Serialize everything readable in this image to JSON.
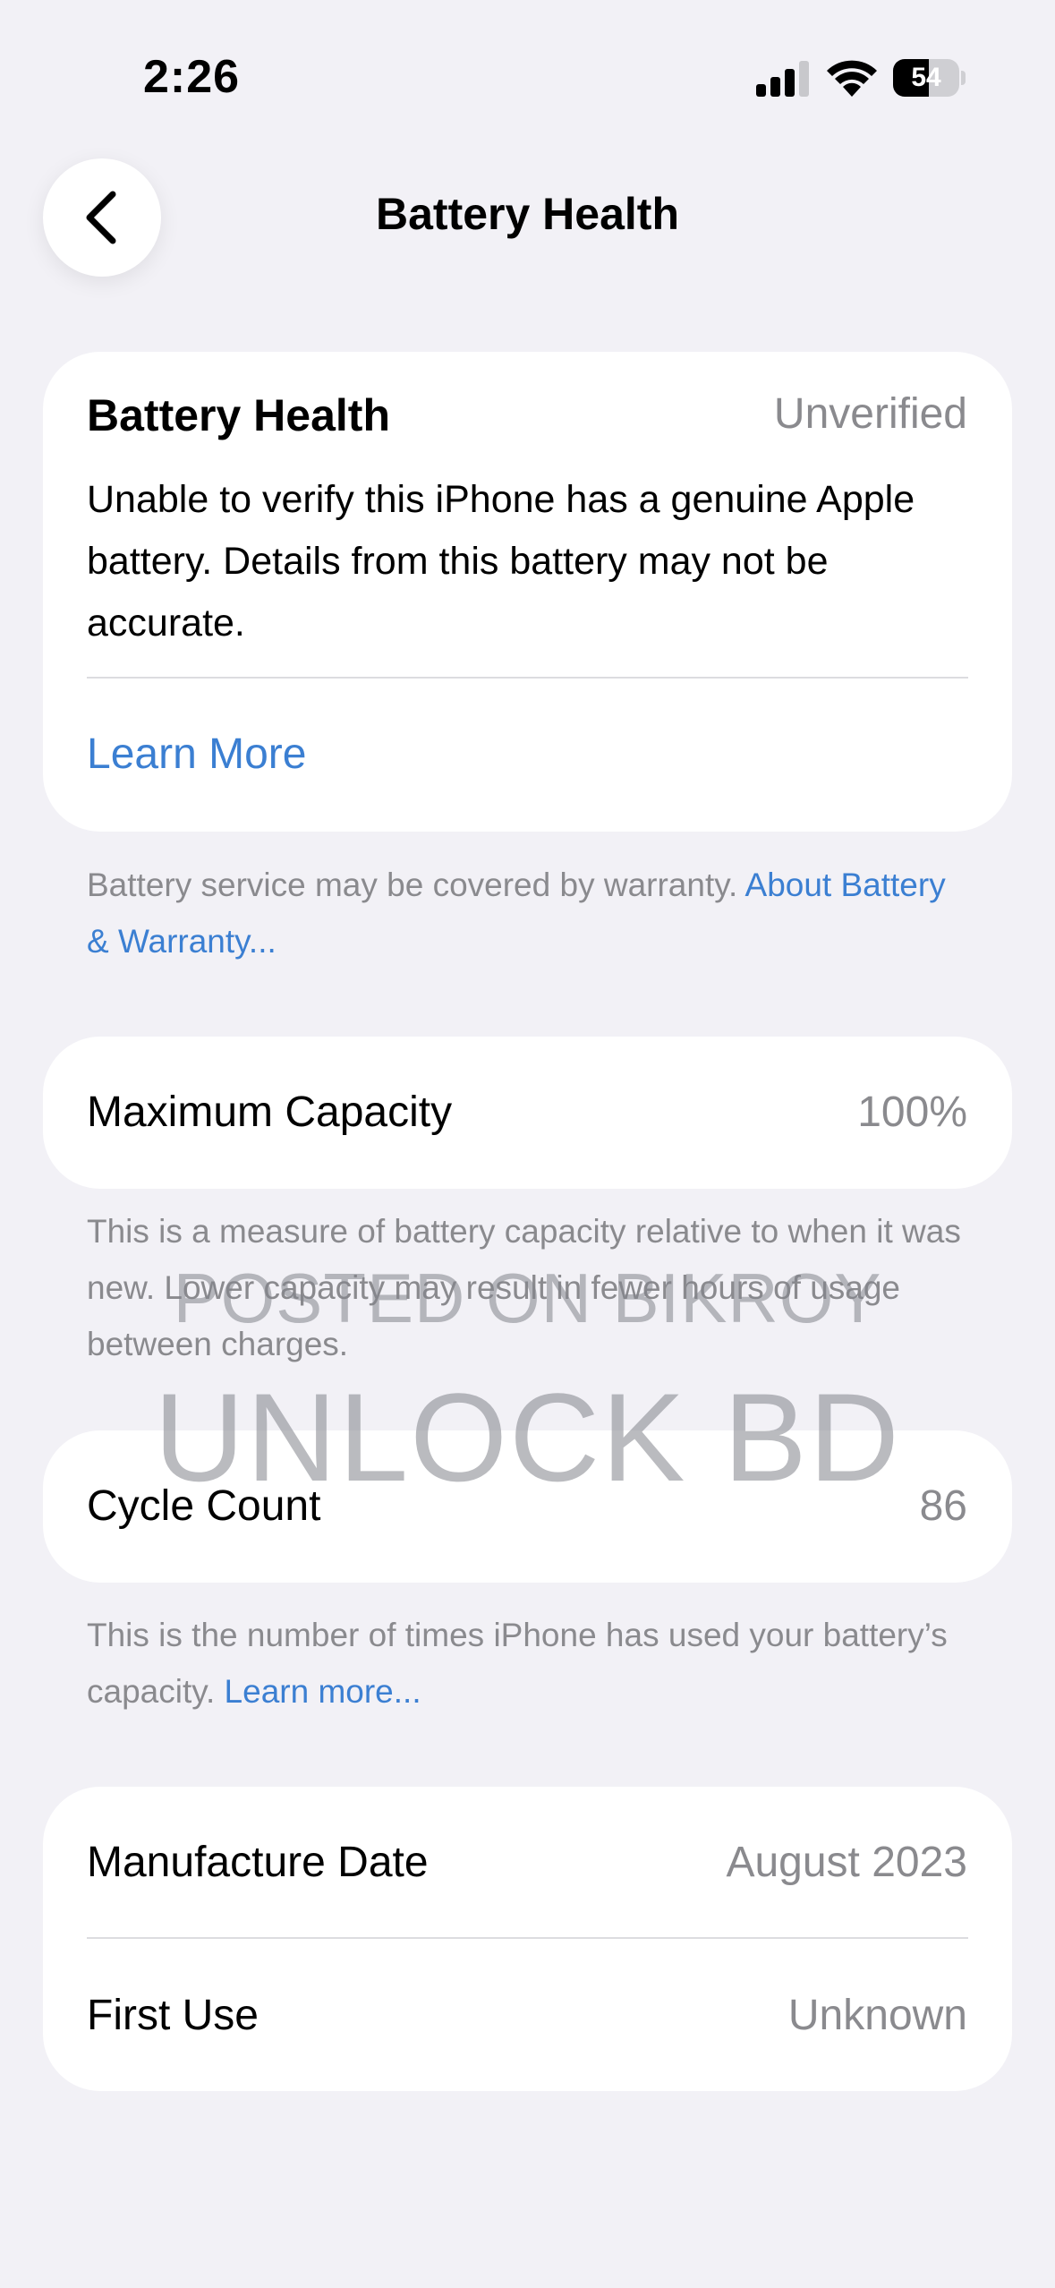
{
  "status_bar": {
    "time": "2:26",
    "battery_level": "54",
    "battery_fraction": 0.54,
    "icons": [
      "cellular-signal-icon",
      "wifi-icon",
      "battery-icon"
    ]
  },
  "nav": {
    "back_icon": "chevron-left-icon",
    "title": "Battery Health"
  },
  "health_card": {
    "title": "Battery Health",
    "status": "Unverified",
    "description": "Unable to verify this iPhone has a genuine Apple battery. Details from this battery may not be accurate.",
    "learn_more": "Learn More"
  },
  "warranty_note": {
    "text": "Battery service may be covered by warranty. ",
    "link": "About Battery & Warranty..."
  },
  "capacity": {
    "label": "Maximum Capacity",
    "value": "100%",
    "note": "This is a measure of battery capacity relative to when it was new. Lower capacity may result in fewer hours of usage between charges."
  },
  "cycle": {
    "label": "Cycle Count",
    "value": "86",
    "note": "This is the number of times iPhone has used your battery’s capacity. ",
    "note_link": "Learn more..."
  },
  "dates": {
    "manufacture_label": "Manufacture Date",
    "manufacture_value": "August 2023",
    "first_use_label": "First Use",
    "first_use_value": "Unknown"
  },
  "watermark": {
    "line1": "POSTED ON BIKROY",
    "line2": "UNLOCK BD"
  },
  "colors": {
    "accent_link": "#3b7fd2",
    "background": "#f2f1f6",
    "secondary_text": "#8a8a8e"
  }
}
